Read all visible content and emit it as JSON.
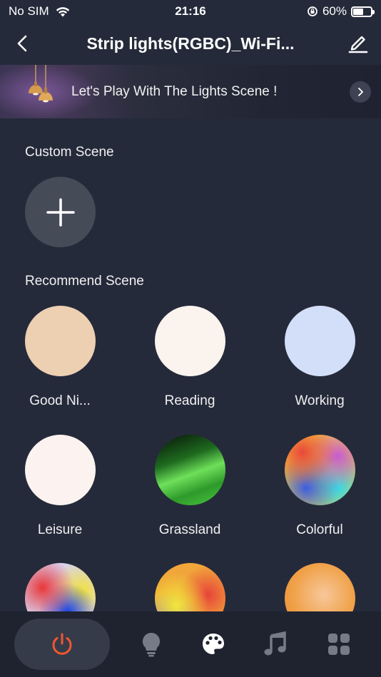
{
  "status_bar": {
    "carrier": "No SIM",
    "time": "21:16",
    "battery": "60%",
    "battery_level": 0.6
  },
  "nav": {
    "title": "Strip lights(RGBC)_Wi-Fi..."
  },
  "banner": {
    "text": "Let's Play With The Lights Scene !"
  },
  "custom_scene": {
    "title": "Custom Scene"
  },
  "recommend_scene": {
    "title": "Recommend Scene",
    "items": [
      {
        "label": "Good Ni...",
        "color": "#edcfb2"
      },
      {
        "label": "Reading",
        "color": "#fbf3ee"
      },
      {
        "label": "Working",
        "color": "#d3def8"
      },
      {
        "label": "Leisure",
        "color": "#fcf3f0"
      },
      {
        "label": "Grassland",
        "color": "#3fa636"
      },
      {
        "label": "Colorful",
        "color": "#f2c23a"
      }
    ]
  },
  "tabs": [
    {
      "name": "power",
      "icon": "power-icon",
      "active": true,
      "color": "#f0572e"
    },
    {
      "name": "light",
      "icon": "bulb-icon",
      "active": false
    },
    {
      "name": "scene",
      "icon": "palette-icon",
      "active": false
    },
    {
      "name": "music",
      "icon": "music-note-icon",
      "active": false
    },
    {
      "name": "more",
      "icon": "grid-icon",
      "active": false
    }
  ],
  "colors": {
    "background": "#252a3a",
    "tab_bar": "#1f2330",
    "accent": "#f0572e"
  }
}
